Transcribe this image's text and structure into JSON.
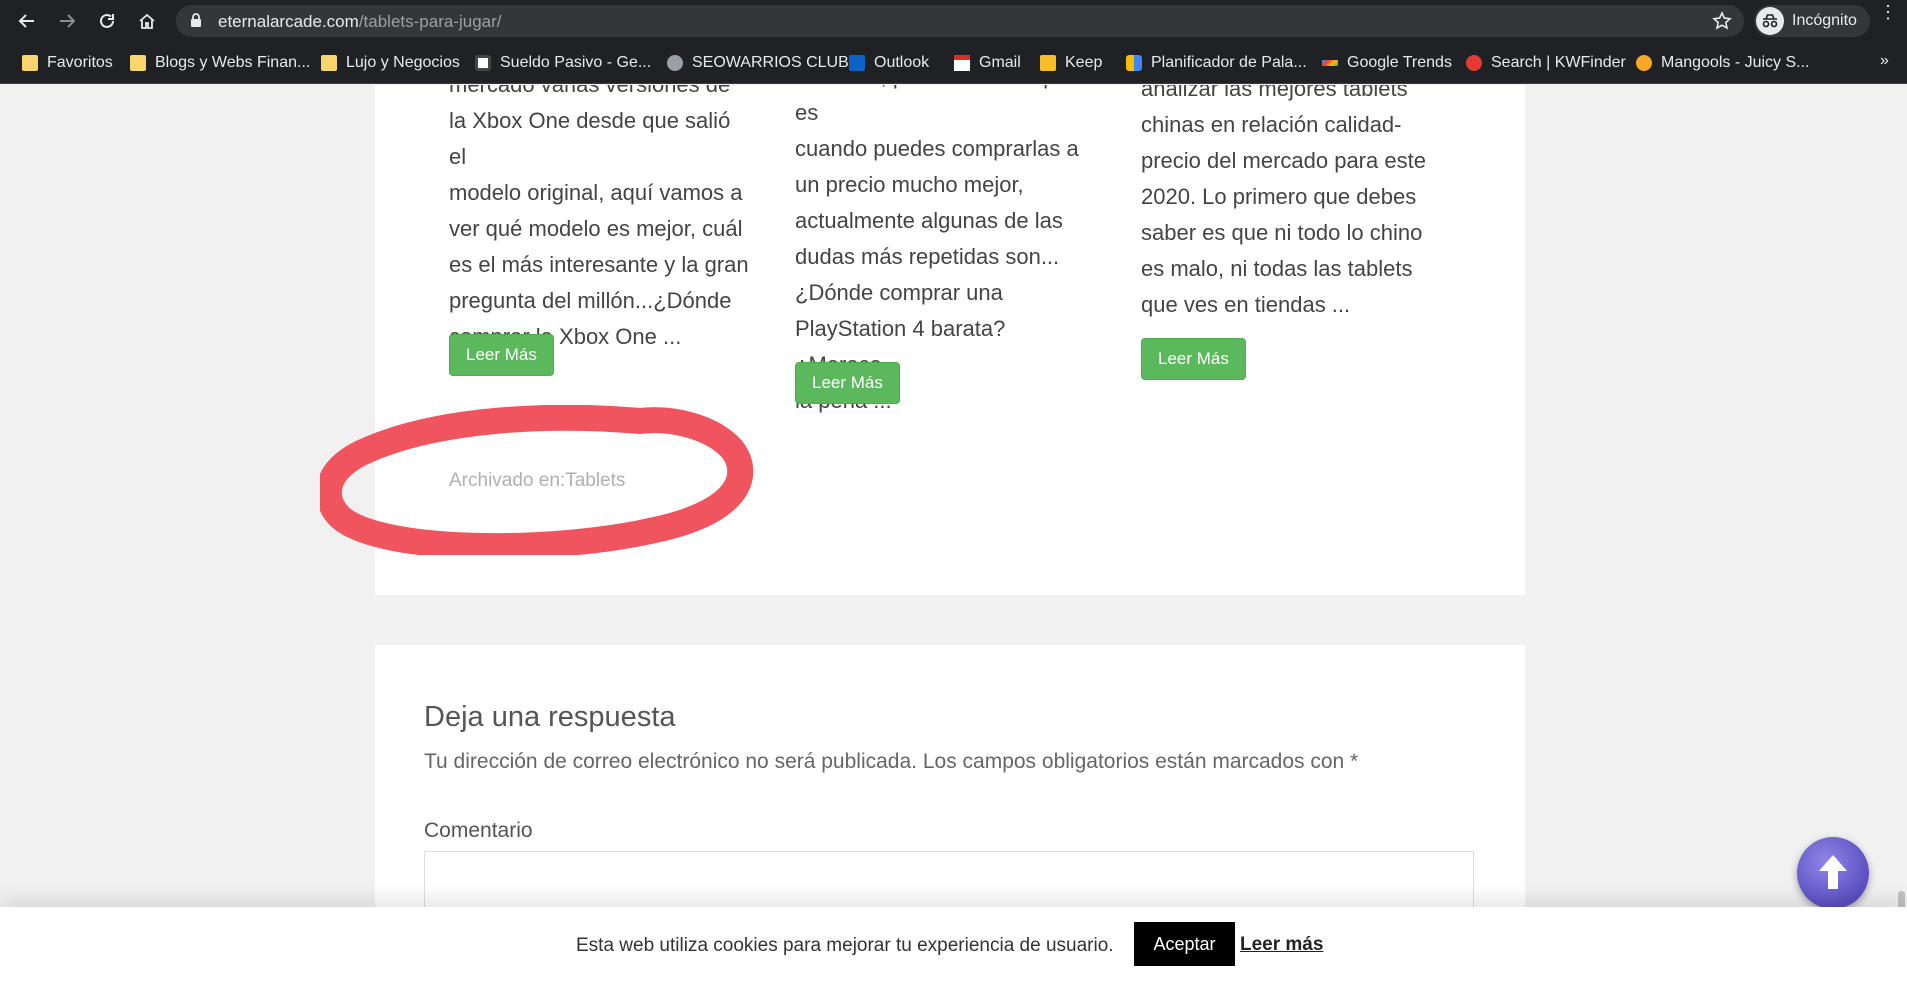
{
  "browser": {
    "url_domain": "eternalarcade.com",
    "url_path": "/tablets-para-jugar/",
    "incognito_label": "Incógnito",
    "bookmarks": [
      {
        "label": "Favoritos",
        "icon": "folder-icon"
      },
      {
        "label": "Blogs y Webs Finan...",
        "icon": "folder-icon"
      },
      {
        "label": "Lujo y Negocios",
        "icon": "folder-icon"
      },
      {
        "label": "Sueldo Pasivo - Ge...",
        "icon": "site-icon"
      },
      {
        "label": "SEOWARRIOS CLUB",
        "icon": "seowarrios-icon"
      },
      {
        "label": "Outlook",
        "icon": "outlook-icon"
      },
      {
        "label": "Gmail",
        "icon": "gmail-icon"
      },
      {
        "label": "Keep",
        "icon": "keep-icon"
      },
      {
        "label": "Planificador de Pala...",
        "icon": "google-ads-icon"
      },
      {
        "label": "Google Trends",
        "icon": "trends-icon"
      },
      {
        "label": "Search | KWFinder",
        "icon": "kwfinder-icon"
      },
      {
        "label": "Mangools - Juicy S...",
        "icon": "mangools-icon"
      }
    ],
    "bookmarks_more": "»"
  },
  "posts": [
    {
      "lines": [
        "mercado varias versiones de",
        "la Xbox One desde que salió el",
        "modelo original, aquí vamos a",
        "ver qué modelo es mejor, cuál",
        "es el más interesante y la gran",
        "pregunta del millón...¿Dónde",
        "comprar la Xbox One ..."
      ],
      "button": "Leer Más"
    },
    {
      "lines": [
        "mercado, pasado un tiempo es",
        "cuando puedes comprarlas a",
        "un precio mucho mejor,",
        "actualmente algunas de las",
        "dudas más repetidas son...",
        "¿Dónde comprar una",
        "PlayStation 4 barata? ¿Merece",
        "la pena ..."
      ],
      "button": "Leer Más"
    },
    {
      "lines": [
        "analizar las mejores tablets",
        "chinas en relación calidad-",
        "precio del mercado para este",
        "2020. Lo primero que debes",
        "saber es que ni todo lo chino",
        "es malo, ni todas las tablets",
        "que ves en tiendas ..."
      ],
      "button": "Leer Más"
    }
  ],
  "archived": {
    "prefix": "Archivado en:",
    "category": "Tablets"
  },
  "annotation_color": "#f0555f",
  "reply": {
    "title": "Deja una respuesta",
    "note": "Tu dirección de correo electrónico no será publicada. Los campos obligatorios están marcados con *",
    "comment_label": "Comentario"
  },
  "cookie": {
    "text": "Esta web utiliza cookies para mejorar tu experiencia de usuario.",
    "accept": "Aceptar",
    "more": "Leer más"
  },
  "colors": {
    "button_green": "#5cb85c",
    "chrome_dark": "#202124"
  }
}
